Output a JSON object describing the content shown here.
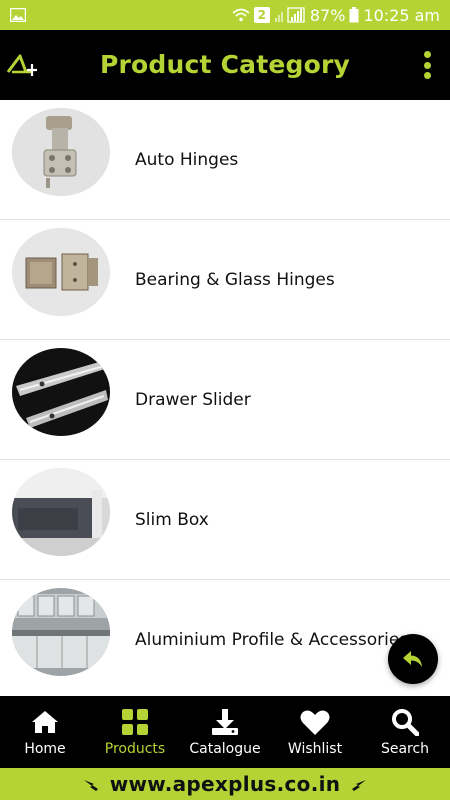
{
  "status_bar": {
    "sim_slot": "2",
    "battery": "87%",
    "time": "10:25 am",
    "icons": [
      "image-icon",
      "wifi-icon",
      "signal-icon",
      "battery-icon"
    ]
  },
  "app_bar": {
    "title": "Product Category",
    "logo": "apex-plus-logo",
    "menu_icon": "kebab-menu-icon"
  },
  "categories": [
    {
      "label": "Auto Hinges",
      "image": "auto-hinge-image"
    },
    {
      "label": "Bearing & Glass Hinges",
      "image": "glass-hinge-image"
    },
    {
      "label": "Drawer Slider",
      "image": "drawer-slider-image"
    },
    {
      "label": "Slim Box",
      "image": "slim-box-image"
    },
    {
      "label": "Aluminium Profile & Accessories",
      "image": "aluminium-profile-image"
    }
  ],
  "fab": {
    "icon": "reply-arrow-icon"
  },
  "bottom_nav": {
    "active": "Products",
    "items": [
      {
        "label": "Home",
        "icon": "home-icon"
      },
      {
        "label": "Products",
        "icon": "grid-icon"
      },
      {
        "label": "Catalogue",
        "icon": "download-icon"
      },
      {
        "label": "Wishlist",
        "icon": "heart-icon"
      },
      {
        "label": "Search",
        "icon": "search-icon"
      }
    ]
  },
  "footer": {
    "url": "www.apexplus.co.in"
  },
  "colors": {
    "accent": "#b5d334",
    "bar": "#000000",
    "text": "#111111",
    "divider": "#e3e3e3"
  }
}
